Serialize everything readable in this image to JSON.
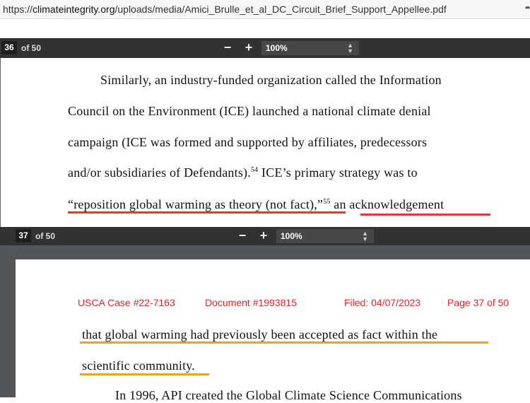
{
  "browser": {
    "url_scheme": "https://",
    "url_host": "climateintegrity.org",
    "url_path": "/uploads/media/Amici_Brulle_et_al_DC_Circuit_Brief_Support_Appellee.pdf",
    "more": "••"
  },
  "toolbar_top": {
    "page": "36",
    "of_pages": "of 50",
    "zoom_out": "−",
    "zoom_in": "+",
    "zoom": "100%"
  },
  "toolbar_bottom": {
    "page": "37",
    "of_pages": "of 50",
    "zoom_out": "−",
    "zoom_in": "+",
    "zoom": "100%"
  },
  "page36": {
    "line1": "Similarly, an industry-funded organization called the Information",
    "line2": "Council on the Environment (ICE) launched a national climate denial",
    "line3": "campaign (ICE was formed and supported by affiliates, predecessors",
    "line4_a": "and/or subsidiaries of Defendants).",
    "fn54": "54",
    "line4_b": "ICE’s primary strategy was to",
    "line5_a": "“reposition global warming as theory (not fact),”",
    "fn55": "55",
    "line5_b": "an acknowledgement"
  },
  "page37": {
    "header": {
      "case": "USCA Case #22-7163",
      "document": "Document #1993815",
      "filed": "Filed: 04/07/2023",
      "page": "Page 37 of 50"
    },
    "line1": "that global warming had previously been accepted as fact within the",
    "line2": "scientific community.",
    "line3": "In 1996, API created the Global Climate Science Communications"
  },
  "colors": {
    "underline_red": "#e23b2e",
    "underline_orange": "#f0a21f",
    "header_red": "#e8272a",
    "toolbar": "#323232"
  }
}
